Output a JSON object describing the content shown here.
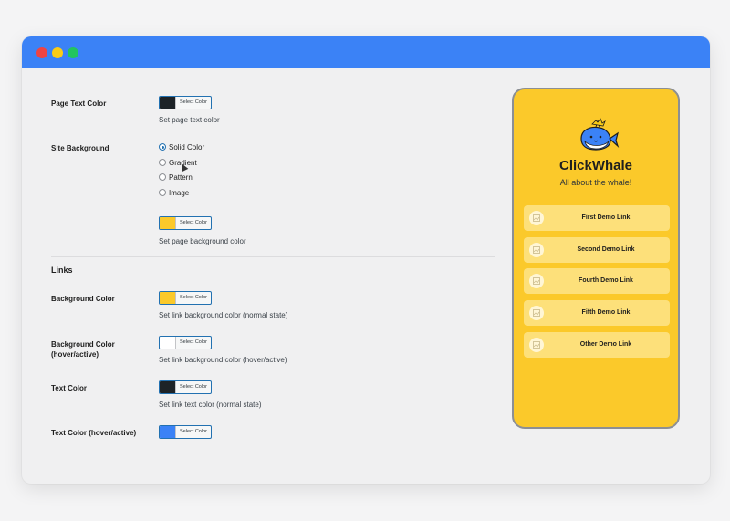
{
  "colors": {
    "window_bar": "#3b82f6",
    "black_swatch": "#1d2327",
    "yellow_swatch": "#fbc92a",
    "white_swatch": "#ffffff",
    "blue_swatch": "#3b82f6"
  },
  "settings": {
    "page_text_color": {
      "label": "Page Text Color",
      "button": "Select Color",
      "help": "Set page text color"
    },
    "site_background": {
      "label": "Site Background",
      "options": [
        "Solid Color",
        "Gradient",
        "Pattern",
        "Image"
      ],
      "selected": "Solid Color",
      "button": "Select Color",
      "help": "Set page background color"
    },
    "links_section": "Links",
    "background_color": {
      "label": "Background Color",
      "button": "Select Color",
      "help": "Set link background color (normal state)"
    },
    "background_color_hover": {
      "label": "Background Color (hover/active)",
      "button": "Select Color",
      "help": "Set link background color (hover/active)"
    },
    "text_color": {
      "label": "Text Color",
      "button": "Select Color",
      "help": "Set link text color (normal state)"
    },
    "text_color_hover": {
      "label": "Text Color (hover/active)",
      "button": "Select Color"
    }
  },
  "preview": {
    "title": "ClickWhale",
    "tagline": "All about the whale!",
    "links": [
      "First Demo Link",
      "Second Demo Link",
      "Fourth Demo Link",
      "Fifth Demo Link",
      "Other Demo Link"
    ]
  }
}
